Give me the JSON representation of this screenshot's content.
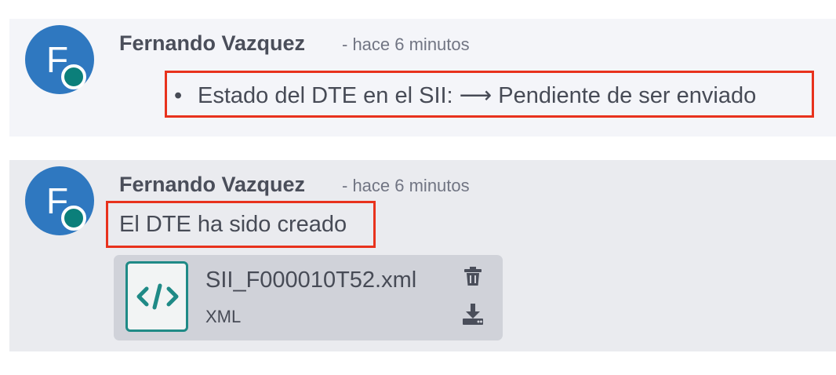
{
  "messages": [
    {
      "avatar_initial": "F",
      "author": "Fernando Vazquez",
      "time": "- hace 6 minutos",
      "bullet_text": "Estado del DTE en el SII: ⟶ Pendiente de ser enviado"
    },
    {
      "avatar_initial": "F",
      "author": "Fernando Vazquez",
      "time": "- hace 6 minutos",
      "body": "El DTE ha sido creado",
      "attachment": {
        "name": "SII_F000010T52.xml",
        "type": "XML",
        "icon": "code-icon"
      }
    }
  ],
  "colors": {
    "avatar": "#2f78c0",
    "status": "#0b7f7a",
    "highlight": "#e8321d",
    "file_icon": "#1f8a86"
  }
}
